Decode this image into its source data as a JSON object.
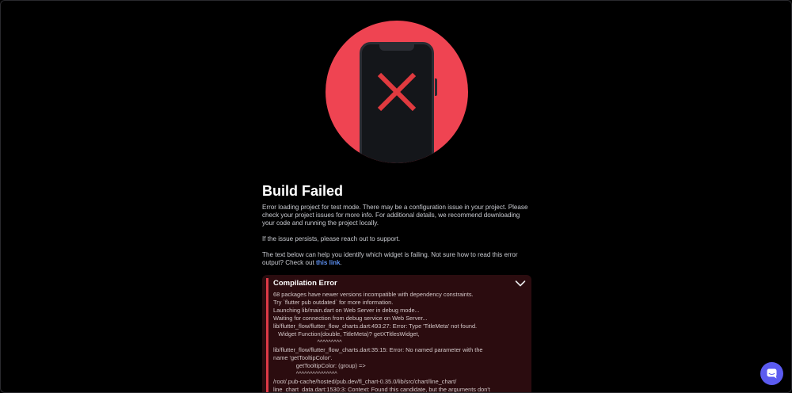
{
  "page": {
    "title": "Build Failed",
    "description": "Error loading project for test mode. There may be a configuration issue in your project. Please check your project issues for more info. For additional details, we recommend downloading your code and running the project locally.",
    "support_note": "If the issue persists, please reach out to support.",
    "help_text_before": "The text below can help you identify which widget is failing. Not sure how to read this error output? Check out ",
    "help_link": "this link",
    "help_text_after": "."
  },
  "error": {
    "title": "Compilation Error",
    "log": "68 packages have newer versions incompatible with dependency constraints.\nTry `flutter pub outdated` for more information.\nLaunching lib/main.dart on Web Server in debug mode...\nWaiting for connection from debug service on Web Server...\nlib/flutter_flow/flutter_flow_charts.dart:493:27: Error: Type 'TitleMeta' not found.\n   Widget Function(double, TitleMeta)? getXTitlesWidget,\n                           ^^^^^^^^^\nlib/flutter_flow/flutter_flow_charts.dart:35:15: Error: No named parameter with the\nname 'getTooltipColor'.\n              getTooltipColor: (group) =>\n              ^^^^^^^^^^^^^^^\n/root/.pub-cache/hosted/pub.dev/fl_chart-0.35.0/lib/src/chart/line_chart/\nline_chart_data.dart:1530:3: Context: Found this candidate, but the arguments don't"
  },
  "icons": {
    "illustration": "phone-error-icon",
    "collapse": "chevron-down-icon",
    "chat": "chat-icon"
  },
  "colors": {
    "background": "#000000",
    "illustration_circle": "#ef4452",
    "error_accent": "#e03a47",
    "error_background": "#2b0c0f",
    "link": "#5a8dee",
    "chat_button": "#5b5bf0"
  }
}
